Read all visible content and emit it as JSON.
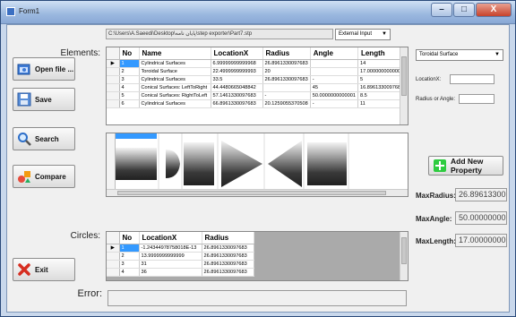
{
  "window": {
    "title": "Form1",
    "min": "–",
    "max": "□",
    "close": "X"
  },
  "path": "C:\\Users\\A.Saeedi\\Desktop\\پایان نامه\\step exporter\\Part7.stp",
  "input_mode": {
    "selected": "External Input"
  },
  "labels": {
    "elements": "Elements:",
    "circles": "Circles:",
    "error": "Error:"
  },
  "buttons": {
    "open": "Open file ...",
    "save": "Save",
    "search": "Search",
    "compare": "Compare",
    "exit": "Exit",
    "add_property": "Add New Property"
  },
  "elements_table": {
    "headers": [
      "No",
      "Name",
      "LocationX",
      "Radius",
      "Angle",
      "Length"
    ],
    "rows": [
      [
        "1",
        "Cylindrical Surfaces",
        "6.99999999999968",
        "26.8961330097683",
        "",
        "14"
      ],
      [
        "2",
        "Toroidal Surface",
        "22.4999999999993",
        "20",
        "",
        "17.0000000000001"
      ],
      [
        "3",
        "Cylindrical Surfaces",
        "33.5",
        "26.8961330097683",
        "-",
        "5"
      ],
      [
        "4",
        "Conical Surfaces: LeftToRight",
        "44.4480665048842",
        "",
        "45",
        "16.8961330097683"
      ],
      [
        "5",
        "Conical Surfaces: RightToLeft",
        "57.1461330097683",
        "-",
        "50.0000000000001",
        "8.5"
      ],
      [
        "6",
        "Cylindrical Surfaces",
        "66.8961330097683",
        "20.1259055370508",
        "-",
        "11"
      ]
    ]
  },
  "circles_table": {
    "headers": [
      "No",
      "LocationX",
      "Radius"
    ],
    "rows": [
      [
        "1",
        "-1.24344978758018E-13",
        "26.8961330097683"
      ],
      [
        "2",
        "13.9999999999999",
        "26.8961330097683"
      ],
      [
        "3",
        "31",
        "26.8961330097683"
      ],
      [
        "4",
        "36",
        "26.8961330097683"
      ]
    ]
  },
  "property": {
    "selected": "Toroidal Surface",
    "location_label": "LocationX:",
    "radius_angle_label": "Radius or Angle:"
  },
  "stats": {
    "max_radius_label": "MaxRadius:",
    "max_radius": "26.89613300",
    "max_angle_label": "MaxAngle:",
    "max_angle": "50.00000000",
    "max_length_label": "MaxLength:",
    "max_length": "17.00000000"
  },
  "colors": {
    "selection": "#3399ff",
    "title_gradient_top": "#cfe0f4",
    "close_button": "#c7422b"
  },
  "icons": [
    "folder-open-icon",
    "floppy-disk-icon",
    "magnifier-icon",
    "compare-shapes-icon",
    "red-x-icon",
    "green-plus-icon"
  ]
}
